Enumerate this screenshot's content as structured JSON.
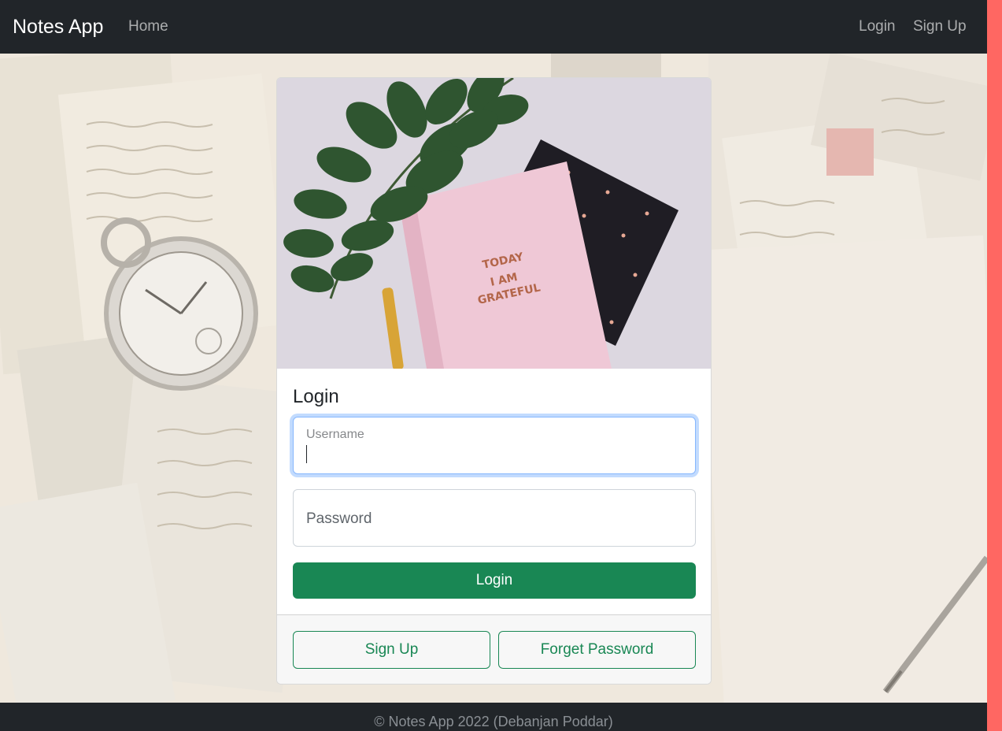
{
  "navbar": {
    "brand": "Notes App",
    "home": "Home",
    "login": "Login",
    "signup": "Sign Up"
  },
  "card": {
    "title": "Login",
    "image_alt": "notebook-with-leaves",
    "notebook_text": [
      "TODAY",
      "I AM",
      "GRATEFUL"
    ],
    "username_label": "Username",
    "password_label": "Password",
    "login_button": "Login",
    "signup_button": "Sign Up",
    "forget_button": "Forget Password"
  },
  "footer": {
    "text": "© Notes App 2022 (Debanjan Poddar)"
  },
  "colors": {
    "navbar": "#212529",
    "primary_green": "#198754",
    "right_bar": "#ff6762"
  }
}
